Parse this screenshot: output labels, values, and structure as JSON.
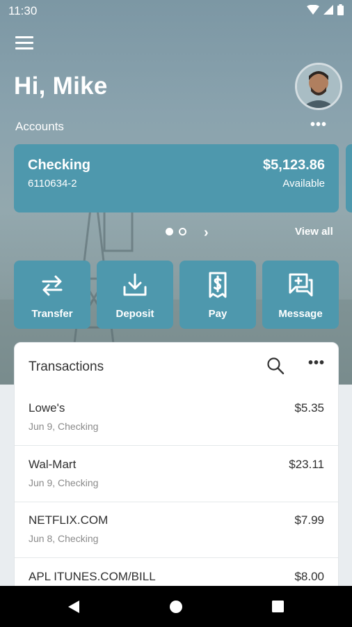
{
  "status_bar": {
    "time": "11:30"
  },
  "header": {
    "greeting": "Hi, Mike"
  },
  "accounts": {
    "label": "Accounts",
    "more_label": "•••",
    "view_all": "View all",
    "pager_next": "›",
    "card": {
      "name": "Checking",
      "number": "6110634-2",
      "balance": "$5,123.86",
      "balance_label": "Available"
    }
  },
  "actions": [
    {
      "label": "Transfer",
      "icon": "transfer-icon"
    },
    {
      "label": "Deposit",
      "icon": "deposit-icon"
    },
    {
      "label": "Pay",
      "icon": "pay-icon"
    },
    {
      "label": "Message",
      "icon": "message-icon"
    }
  ],
  "transactions": {
    "title": "Transactions",
    "more_label": "•••",
    "items": [
      {
        "merchant": "Lowe's",
        "meta": "Jun 9, Checking",
        "amount": "$5.35"
      },
      {
        "merchant": "Wal-Mart",
        "meta": "Jun 9, Checking",
        "amount": "$23.11"
      },
      {
        "merchant": "NETFLIX.COM",
        "meta": "Jun 8, Checking",
        "amount": "$7.99"
      },
      {
        "merchant": "APL ITUNES.COM/BILL",
        "meta": "",
        "amount": "$8.00"
      }
    ]
  },
  "colors": {
    "accent": "#4e98ad",
    "hero_top": "#7c97a4",
    "background": "#e9edf0",
    "navbar": "#000000"
  }
}
